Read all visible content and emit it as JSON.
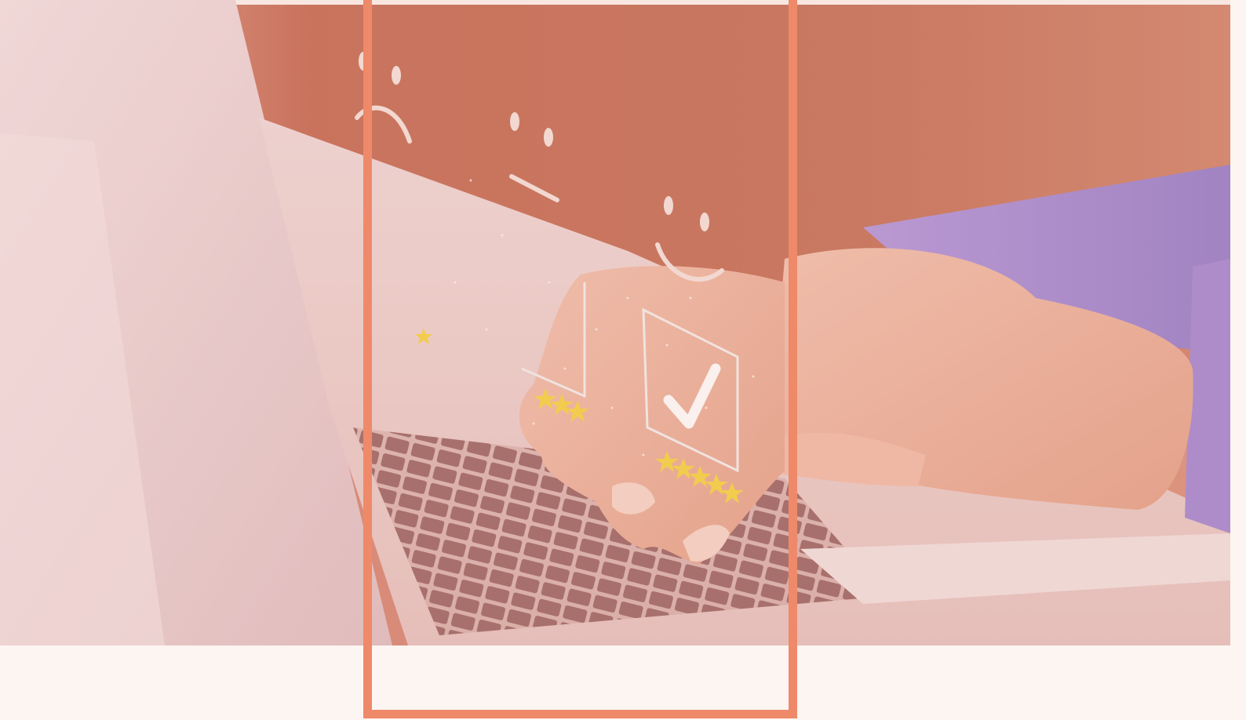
{
  "image": {
    "subject": "hands-typing-on-laptop-with-satisfaction-rating-icons",
    "tint_color": "#d9826a",
    "frame_color": "#ee8a69",
    "background_color": "#fdf5f2",
    "icons": [
      "sad-face-icon",
      "neutral-face-icon",
      "happy-face-icon",
      "checkmark-icon",
      "star-rating-icon"
    ],
    "star_ratings": {
      "left_checkbox_stars": 3,
      "right_checkbox_stars": 5
    }
  }
}
